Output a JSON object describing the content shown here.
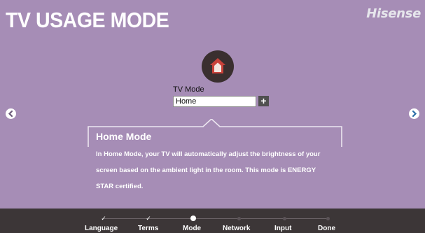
{
  "header": {
    "title": "TV USAGE MODE",
    "brand": "Hisense"
  },
  "mode": {
    "icon": "home-icon",
    "label": "TV Mode",
    "value": "Home",
    "options_button": "+"
  },
  "navigation": {
    "prev_icon": "chevron-left-icon",
    "next_icon": "chevron-right-icon"
  },
  "info": {
    "title": "Home Mode",
    "text": "In Home Mode, your TV will automatically adjust the brightness of your screen based on the ambient light in the room. This mode is ENERGY STAR  certified."
  },
  "steps": [
    {
      "label": "Language",
      "state": "done",
      "mark": "✓"
    },
    {
      "label": "Terms",
      "state": "done",
      "mark": "✓"
    },
    {
      "label": "Mode",
      "state": "current",
      "mark": ""
    },
    {
      "label": "Network",
      "state": "pending",
      "mark": ""
    },
    {
      "label": "Input",
      "state": "pending",
      "mark": ""
    },
    {
      "label": "Done",
      "state": "pending",
      "mark": ""
    }
  ],
  "colors": {
    "background": "#a68db6",
    "bottom_bar": "#3c3637",
    "icon_circle": "#3a2f2f",
    "house": "#c9423a"
  }
}
